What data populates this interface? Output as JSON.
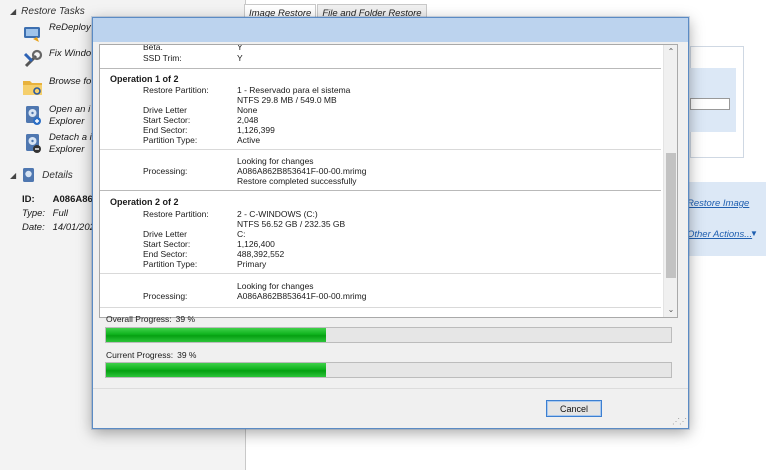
{
  "left_pane": {
    "restore_tasks_header": "Restore Tasks",
    "tasks": [
      {
        "label": "ReDeploy",
        "icon": "redeploy-icon"
      },
      {
        "label": "Fix Windo",
        "icon": "fix-tools-icon"
      },
      {
        "label": "Browse fo",
        "icon": "folder-browse-icon"
      },
      {
        "label": "Open an i\nExplorer",
        "icon": "disk-open-icon"
      },
      {
        "label": "Detach a i\nExplorer",
        "icon": "disk-detach-icon"
      }
    ],
    "details_header": "Details",
    "details": [
      {
        "key": "ID:",
        "value": "A086A862"
      },
      {
        "key": "Type:",
        "value": "Full"
      },
      {
        "key": "Date:",
        "value": "14/01/202"
      }
    ]
  },
  "tabs": [
    "Image Restore",
    "File and Folder Restore"
  ],
  "right_links": {
    "restore_image": "Restore Image",
    "other_actions": "Other Actions..."
  },
  "log": {
    "top_rows": [
      {
        "label": "Beta.",
        "value": "Y"
      },
      {
        "label": "SSD Trim:",
        "value": "Y"
      }
    ],
    "operations": [
      {
        "title": "Operation 1 of 2",
        "rows": [
          {
            "label": "Restore Partition:",
            "value": "1 - Reservado para el sistema"
          },
          {
            "label": "",
            "value": "NTFS 29.8 MB / 549.0 MB"
          },
          {
            "label": "Drive Letter",
            "value": "None"
          },
          {
            "label": "Start Sector:",
            "value": "2,048"
          },
          {
            "label": "End Sector:",
            "value": "1,126,399"
          },
          {
            "label": "Partition Type:",
            "value": "Active"
          }
        ],
        "processing_label": "Processing:",
        "processing_lines": [
          "Looking for changes",
          "A086A862B853641F-00-00.mrimg",
          "Restore completed successfully"
        ]
      },
      {
        "title": "Operation 2 of 2",
        "rows": [
          {
            "label": "Restore Partition:",
            "value": "2 - C-WINDOWS (C:)"
          },
          {
            "label": "",
            "value": "NTFS 56.52 GB / 232.35 GB"
          },
          {
            "label": "Drive Letter",
            "value": "C:"
          },
          {
            "label": "Start Sector:",
            "value": "1,126,400"
          },
          {
            "label": "End Sector:",
            "value": "488,392,552"
          },
          {
            "label": "Partition Type:",
            "value": "Primary"
          }
        ],
        "processing_label": "Processing:",
        "processing_lines": [
          "Looking for changes",
          "A086A862B853641F-00-00.mrimg"
        ]
      }
    ]
  },
  "progress": {
    "overall_label": "Overall Progress:",
    "overall_value": "39 %",
    "overall_fraction": 0.39,
    "current_label": "Current Progress:",
    "current_value": "39 %",
    "current_fraction": 0.39
  },
  "buttons": {
    "cancel": "Cancel"
  },
  "colors": {
    "progress_green": "#0fb31d",
    "link_blue": "#1f5fb0",
    "titlebar_blue": "#bcd3ee"
  }
}
